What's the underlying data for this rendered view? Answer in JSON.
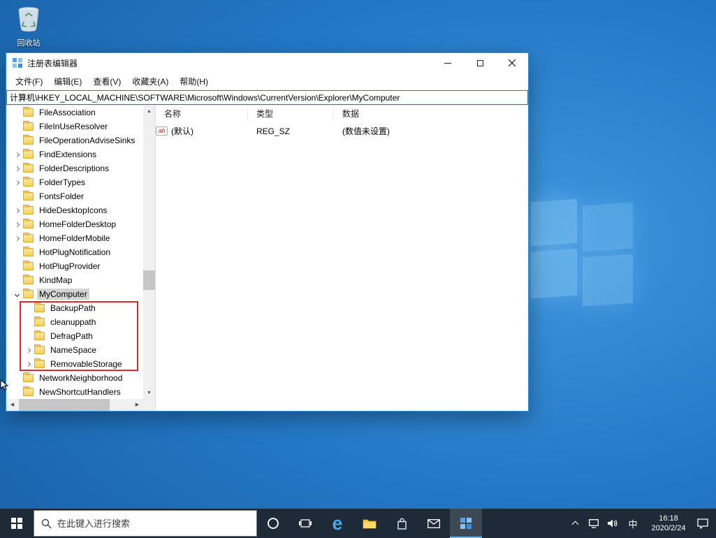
{
  "colors": {
    "accent": "#0078d7",
    "taskbar_bg": "#1e2a38",
    "highlight_red": "#e02a2a",
    "selection_gray": "#d4d4d4",
    "folder_yellow": "#f7ce57"
  },
  "desktop": {
    "recycle_bin_label": "回收站"
  },
  "regedit": {
    "title": "注册表编辑器",
    "menu": [
      {
        "name": "file",
        "label": "文件(F)"
      },
      {
        "name": "edit",
        "label": "编辑(E)"
      },
      {
        "name": "view",
        "label": "查看(V)"
      },
      {
        "name": "favorites",
        "label": "收藏夹(A)"
      },
      {
        "name": "help",
        "label": "帮助(H)"
      }
    ],
    "address": "计算机\\HKEY_LOCAL_MACHINE\\SOFTWARE\\Microsoft\\Windows\\CurrentVersion\\Explorer\\MyComputer",
    "tree": [
      {
        "label": "FileAssociation",
        "chevron": "none",
        "level": 0
      },
      {
        "label": "FileInUseResolver",
        "chevron": "none",
        "level": 0
      },
      {
        "label": "FileOperationAdviseSinks",
        "chevron": "none",
        "level": 0
      },
      {
        "label": "FindExtensions",
        "chevron": "right",
        "level": 0
      },
      {
        "label": "FolderDescriptions",
        "chevron": "right",
        "level": 0
      },
      {
        "label": "FolderTypes",
        "chevron": "right",
        "level": 0
      },
      {
        "label": "FontsFolder",
        "chevron": "none",
        "level": 0
      },
      {
        "label": "HideDesktopIcons",
        "chevron": "right",
        "level": 0
      },
      {
        "label": "HomeFolderDesktop",
        "chevron": "right",
        "level": 0
      },
      {
        "label": "HomeFolderMobile",
        "chevron": "right",
        "level": 0
      },
      {
        "label": "HotPlugNotification",
        "chevron": "none",
        "level": 0
      },
      {
        "label": "HotPlugProvider",
        "chevron": "none",
        "level": 0
      },
      {
        "label": "KindMap",
        "chevron": "none",
        "level": 0
      },
      {
        "label": "MyComputer",
        "chevron": "down",
        "level": 0,
        "selected": true
      },
      {
        "label": "BackupPath",
        "chevron": "none",
        "level": 1
      },
      {
        "label": "cleanuppath",
        "chevron": "none",
        "level": 1
      },
      {
        "label": "DefragPath",
        "chevron": "none",
        "level": 1
      },
      {
        "label": "NameSpace",
        "chevron": "right",
        "level": 1
      },
      {
        "label": "RemovableStorage",
        "chevron": "right",
        "level": 1
      },
      {
        "label": "NetworkNeighborhood",
        "chevron": "none",
        "level": 0
      },
      {
        "label": "NewShortcutHandlers",
        "chevron": "none",
        "level": 0
      }
    ],
    "list": {
      "columns": [
        {
          "name": "name",
          "label": "名称"
        },
        {
          "name": "type",
          "label": "类型"
        },
        {
          "name": "data",
          "label": "数据"
        }
      ],
      "rows": [
        {
          "name": "(默认)",
          "type": "REG_SZ",
          "data": "(数值未设置)"
        }
      ]
    }
  },
  "taskbar": {
    "search_placeholder": "在此键入进行搜索",
    "icons": {
      "edge": "e"
    },
    "tray": {
      "ime": "中",
      "time": "16:18",
      "date": "2020/2/24"
    }
  }
}
